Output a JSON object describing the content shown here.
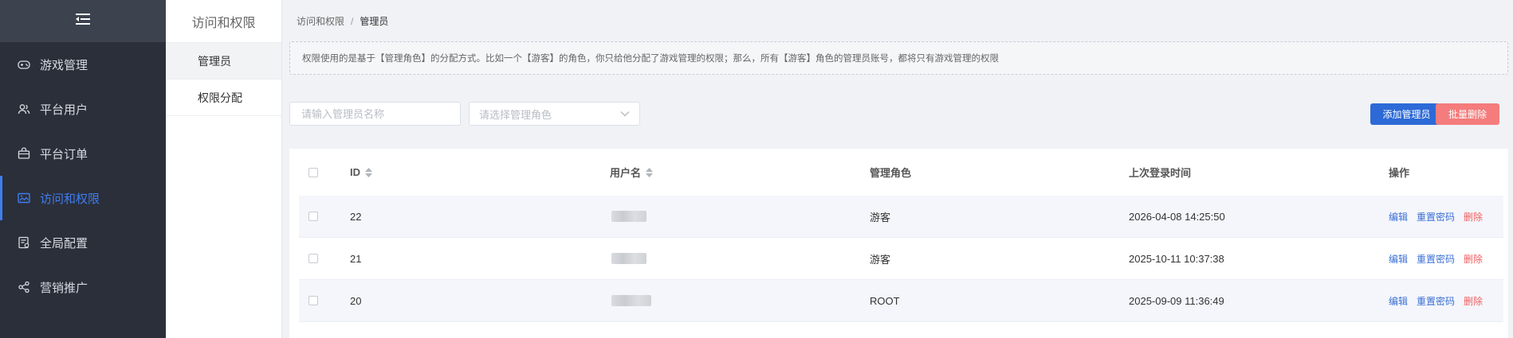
{
  "sidebar": {
    "items": [
      {
        "label": "游戏管理",
        "icon": "gamepad-icon"
      },
      {
        "label": "平台用户",
        "icon": "users-icon"
      },
      {
        "label": "平台订单",
        "icon": "bag-icon"
      },
      {
        "label": "访问和权限",
        "icon": "image-icon",
        "active": true
      },
      {
        "label": "全局配置",
        "icon": "config-icon"
      },
      {
        "label": "营销推广",
        "icon": "share-icon"
      }
    ]
  },
  "subnav": {
    "title": "访问和权限",
    "items": [
      {
        "label": "管理员",
        "active": true
      },
      {
        "label": "权限分配"
      }
    ]
  },
  "breadcrumb": {
    "parent": "访问和权限",
    "separator": "/",
    "current": "管理员"
  },
  "notice": "权限使用的是基于【管理角色】的分配方式。比如一个【游客】的角色，你只给他分配了游戏管理的权限；那么，所有【游客】角色的管理员账号，都将只有游戏管理的权限",
  "filters": {
    "name_placeholder": "请输入管理员名称",
    "name_value": "",
    "role_placeholder": "请选择管理角色"
  },
  "actions": {
    "add": "添加管理员",
    "batch_delete": "批量删除"
  },
  "table": {
    "headers": {
      "id": "ID",
      "username": "用户名",
      "role": "管理角色",
      "last_login": "上次登录时间",
      "ops": "操作"
    },
    "rows": [
      {
        "id": "22",
        "role": "游客",
        "last_login": "2026-04-08 14:25:50"
      },
      {
        "id": "21",
        "role": "游客",
        "last_login": "2025-10-11 10:37:38"
      },
      {
        "id": "20",
        "role": "ROOT",
        "last_login": "2025-09-09 11:36:49"
      }
    ],
    "ops": {
      "edit": "编辑",
      "reset": "重置密码",
      "delete": "删除"
    }
  },
  "colors": {
    "sidebar_bg": "#2b2f3a",
    "accent": "#3f7df0",
    "primary_btn": "#2d6ad7",
    "danger_btn": "#f47c7c",
    "danger_link": "#f06060"
  }
}
